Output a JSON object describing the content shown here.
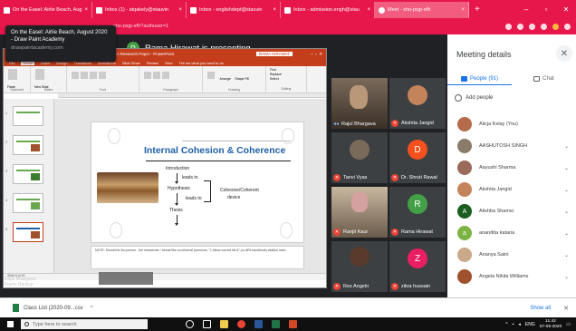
{
  "browser": {
    "tabs": [
      {
        "title": "On the Easel: Airlie Beach, Aug",
        "active": false
      },
      {
        "title": "Inbox (1) - atqakely@stauvin",
        "active": false
      },
      {
        "title": "Inbox - englishdept@stauvin",
        "active": false
      },
      {
        "title": "Inbox - admission.engh@stau",
        "active": false
      },
      {
        "title": "Meet - sho-pxjp-efh",
        "active": true
      }
    ],
    "new_tab": "+",
    "address": "sho-pxjp-efh?authuser=1"
  },
  "tooltip": {
    "title": "On the Easel: Airlie Beach, August 2020 - Draw Paint Academy",
    "domain": "drawpaintacademy.com"
  },
  "meet": {
    "presenter_initial": "R",
    "presenting_text": "Rama Hirawat is presenting",
    "participants": [
      {
        "name": "Rajul Bhargava",
        "type": "video"
      },
      {
        "name": "Akshita Jangid",
        "type": "photo"
      },
      {
        "name": "Tanvi Vyas",
        "type": "photo"
      },
      {
        "name": "Dr. Shruti Rawal",
        "type": "initial",
        "initial": "D",
        "color": "#f4511e"
      },
      {
        "name": "Ranjit Kaur",
        "type": "video"
      },
      {
        "name": "Rama Hirawat",
        "type": "initial",
        "initial": "R",
        "color": "#43a047"
      },
      {
        "name": "Res Angelo",
        "type": "photo"
      },
      {
        "name": "zikra hussain",
        "type": "initial",
        "initial": "Z",
        "color": "#e91e63"
      }
    ]
  },
  "ppt": {
    "title": "Writing A Research Paper - PowerPoint",
    "user": "RAMA HIRAWAT",
    "menu": [
      "File",
      "Home",
      "Insert",
      "Design",
      "Transitions",
      "Animations",
      "Slide Show",
      "Review",
      "View",
      "Tell me what you want to do"
    ],
    "ribbon_groups": [
      "Clipboard",
      "Slides",
      "Font",
      "Paragraph",
      "Drawing",
      "Editing"
    ],
    "ribbon_labels": {
      "paste": "Paste",
      "new_slide": "New Slide",
      "shape_fill": "Shape Fill",
      "arrange": "Arrange",
      "find": "Find",
      "replace": "Replace",
      "select": "Select"
    },
    "slide": {
      "title": "Internal Cohesion & Coherence",
      "flow": [
        "Introduction",
        "leads to",
        "Hypothesis",
        "leads to",
        "Thesis",
        "Cohesive/Coherent",
        "device"
      ]
    },
    "notes": "NOTE: Should be 3rd person - the researcher / formal like no informal pronouns. \"I, follow correct MLA\" (or APA handbook) citation rules",
    "status": "Slide 5 of 18",
    "caption_line1": "Trajul Bhargava",
    "caption_line2": "Teams Backup"
  },
  "panel": {
    "title": "Meeting details",
    "tab_people": "People (91)",
    "tab_chat": "Chat",
    "add_people": "Add people",
    "people": [
      {
        "name": "Alicja Kelay (You)",
        "avatar": "photo",
        "color": "#b56b4a"
      },
      {
        "name": "AASHUTOSH SINGH",
        "avatar": "photo",
        "color": "#8a7a6a"
      },
      {
        "name": "Aayushi Sharma",
        "avatar": "photo",
        "color": "#9a6a5a"
      },
      {
        "name": "Akshita Jangid",
        "avatar": "photo",
        "color": "#c4835a"
      },
      {
        "name": "Alishba Shamsi",
        "avatar": "initial",
        "initial": "A",
        "color": "#1b5e20"
      },
      {
        "name": "anandita kataria",
        "avatar": "initial",
        "initial": "a",
        "color": "#7cb342"
      },
      {
        "name": "Ananya Saini",
        "avatar": "photo",
        "color": "#c9a98a"
      },
      {
        "name": "Angela Nikita Williams",
        "avatar": "photo",
        "color": "#a0522d"
      }
    ]
  },
  "downloads": {
    "file": "Class List (2020-09...csv",
    "show_all": "Show all",
    "close": "✕"
  },
  "taskbar": {
    "search_placeholder": "Type here to search",
    "lang": "ENG",
    "time": "11:42",
    "date": "07-09-2020"
  },
  "colors": {
    "chrome_accent": "#e8174b",
    "meet_bg": "#202124",
    "ppt_accent": "#c43e1c",
    "slide_title": "#1f5fa8",
    "link_blue": "#1a73e8"
  }
}
